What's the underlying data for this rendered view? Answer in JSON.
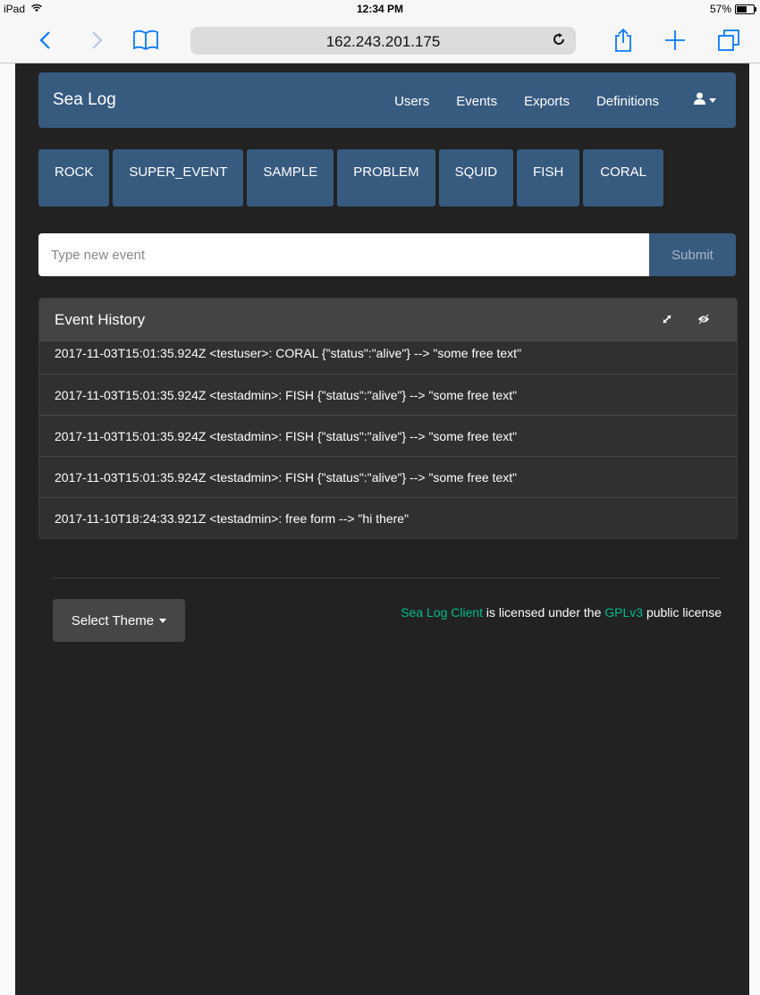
{
  "status_bar": {
    "device": "iPad",
    "time": "12:34 PM",
    "battery": "57%"
  },
  "browser": {
    "url": "162.243.201.175"
  },
  "navbar": {
    "brand": "Sea Log",
    "links": [
      "Users",
      "Events",
      "Exports",
      "Definitions"
    ]
  },
  "categories": [
    "ROCK",
    "SUPER_EVENT",
    "SAMPLE",
    "PROBLEM",
    "SQUID",
    "FISH",
    "CORAL"
  ],
  "event_input": {
    "placeholder": "Type new event",
    "submit_label": "Submit"
  },
  "event_history": {
    "title": "Event History",
    "events": [
      "2017-11-03T15:01:35.924Z <testuser>: CORAL {\"status\":\"alive\"} --> \"some free text\"",
      "2017-11-03T15:01:35.924Z <testadmin>: FISH {\"status\":\"alive\"} --> \"some free text\"",
      "2017-11-03T15:01:35.924Z <testadmin>: FISH {\"status\":\"alive\"} --> \"some free text\"",
      "2017-11-03T15:01:35.924Z <testadmin>: FISH {\"status\":\"alive\"} --> \"some free text\"",
      "2017-11-10T18:24:33.921Z <testadmin>: free form --> \"hi there\""
    ]
  },
  "footer": {
    "theme_button": "Select Theme",
    "license_link_1": "Sea Log Client",
    "license_text_1": " is licensed under the ",
    "license_link_2": "GPLv3",
    "license_text_2": " public license"
  },
  "colors": {
    "background": "#222222",
    "navbar": "#375a7f",
    "link_accent": "#00bc8c",
    "panel_header": "#444444",
    "safari_blue": "#0a7aff"
  }
}
